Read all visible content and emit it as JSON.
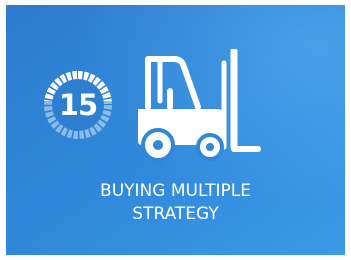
{
  "tile": {
    "badge_number": "15",
    "icon": "forklift-icon",
    "title_line_1": "BUYING MULTIPLE",
    "title_line_2": "STRATEGY"
  },
  "colors": {
    "background_start": "#2d7ccd",
    "background_end": "#3b9ae8",
    "text": "#ffffff"
  }
}
